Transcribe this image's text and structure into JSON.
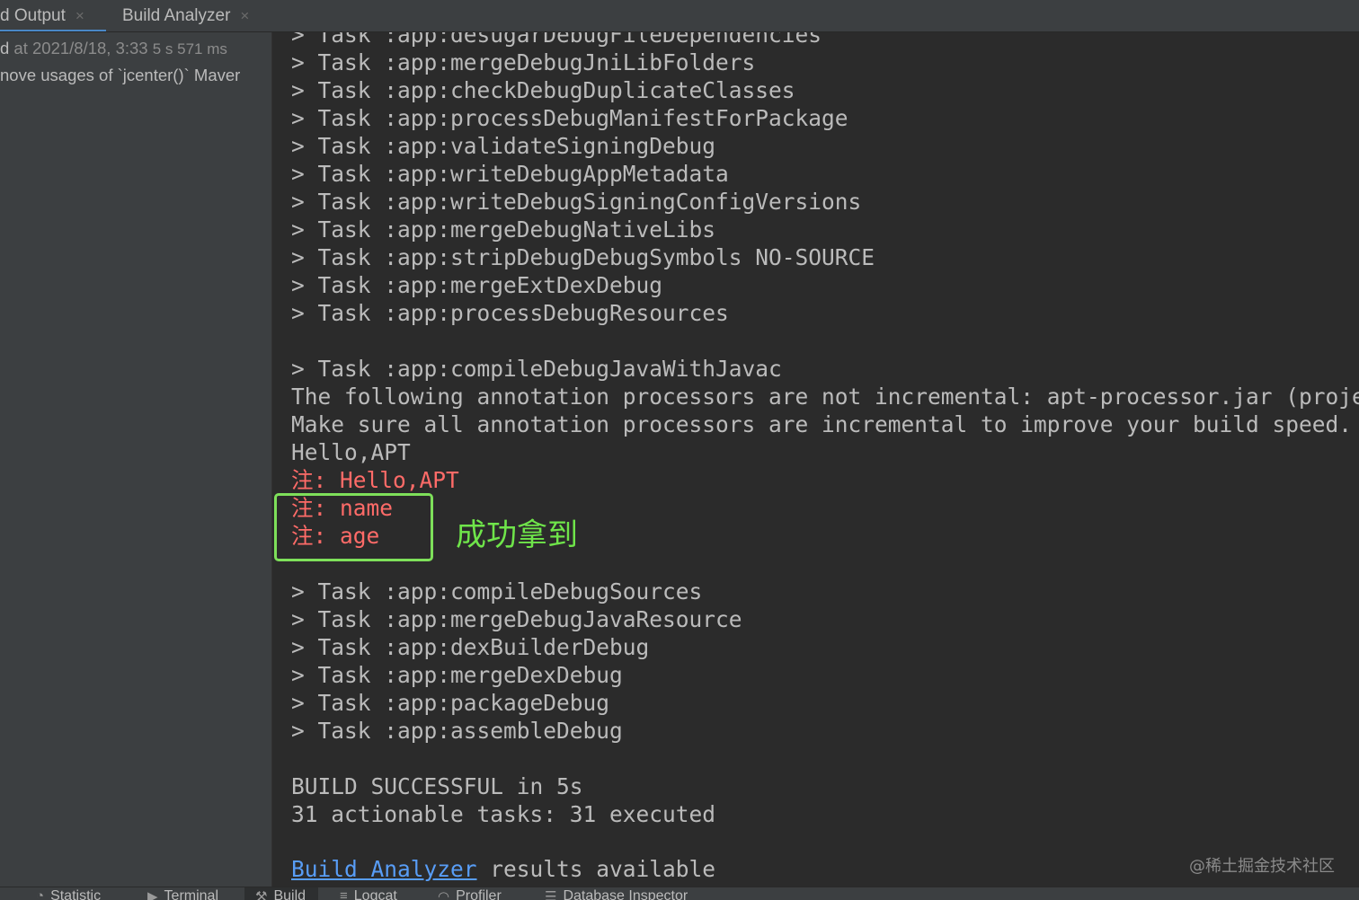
{
  "tabs": [
    {
      "label": "d Output",
      "close": "×"
    },
    {
      "label": "Build Analyzer",
      "close": "×"
    }
  ],
  "sidebar": {
    "row1_prefix": "d",
    "row1_time": " at 2021/8/18, 3:33 ",
    "row1_duration": "5 s 571 ms",
    "row2": "nove usages of `jcenter()` Maver"
  },
  "console": {
    "lines": [
      "> Task :app:desugarDebugFileDependencies",
      "> Task :app:mergeDebugJniLibFolders",
      "> Task :app:checkDebugDuplicateClasses",
      "> Task :app:processDebugManifestForPackage",
      "> Task :app:validateSigningDebug",
      "> Task :app:writeDebugAppMetadata",
      "> Task :app:writeDebugSigningConfigVersions",
      "> Task :app:mergeDebugNativeLibs",
      "> Task :app:stripDebugDebugSymbols NO-SOURCE",
      "> Task :app:mergeExtDexDebug",
      "> Task :app:processDebugResources",
      "",
      "> Task :app:compileDebugJavaWithJavac",
      "The following annotation processors are not incremental: apt-processor.jar (proje",
      "Make sure all annotation processors are incremental to improve your build speed.",
      "Hello,APT",
      "注: Hello,APT",
      "注: name",
      "注: age",
      "",
      "> Task :app:compileDebugSources",
      "> Task :app:mergeDebugJavaResource",
      "> Task :app:dexBuilderDebug",
      "> Task :app:mergeDexDebug",
      "> Task :app:packageDebug",
      "> Task :app:assembleDebug",
      "",
      "BUILD SUCCESSFUL in 5s",
      "31 actionable tasks: 31 executed",
      "",
      ""
    ],
    "link_text": "Build Analyzer",
    "link_suffix": " results available"
  },
  "annotation": "成功拿到",
  "watermark": "@稀土掘金技术社区",
  "bottom_tabs": [
    {
      "label": "Statistic",
      "icon": "pie-chart-icon"
    },
    {
      "label": "Terminal",
      "icon": "terminal-icon"
    },
    {
      "label": "Build",
      "icon": "hammer-icon"
    },
    {
      "label": "Logcat",
      "icon": "logcat-icon"
    },
    {
      "label": "Profiler",
      "icon": "gauge-icon"
    },
    {
      "label": "Database Inspector",
      "icon": "database-icon"
    }
  ],
  "colors": {
    "console_bg": "#2b2b2b",
    "panel_bg": "#3c3f41",
    "text": "#bbbbbb",
    "error_red": "#ff6b68",
    "link_blue": "#589df6",
    "annotation_green": "#6fe54a"
  }
}
